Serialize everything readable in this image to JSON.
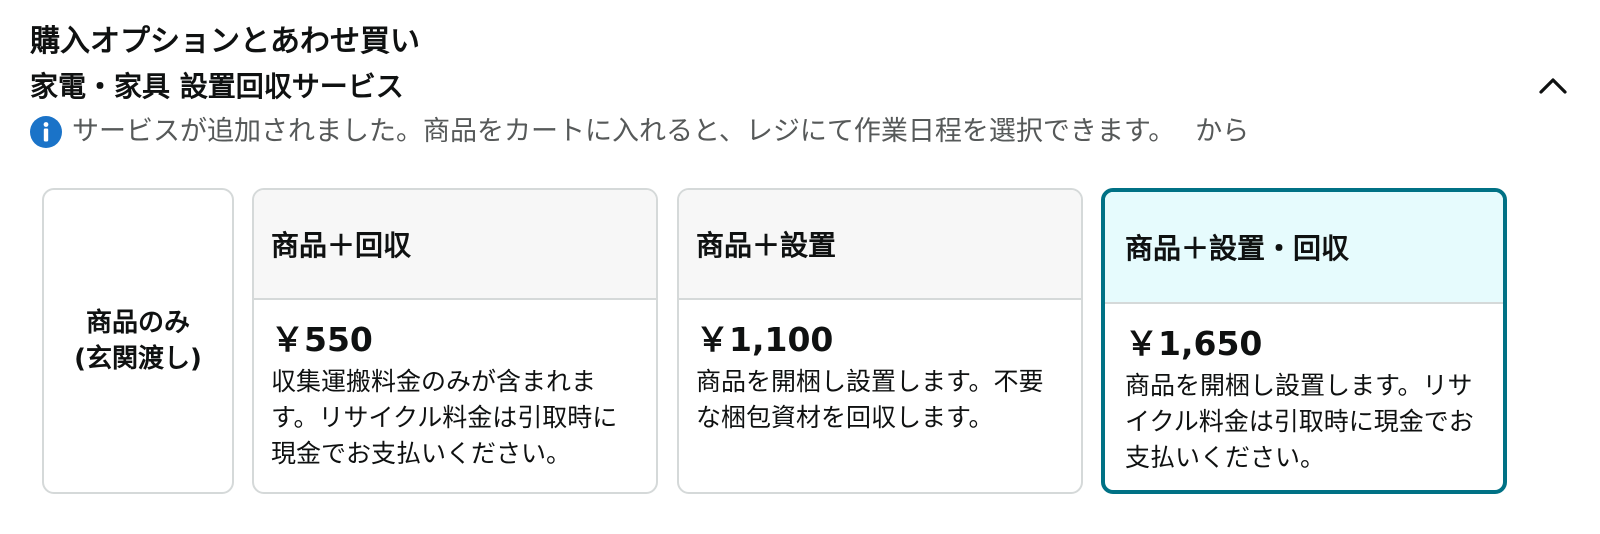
{
  "header": {
    "title": "購入オプションとあわせ買い",
    "subtitle": "家電・家具 設置回収サービス"
  },
  "notice": {
    "icon": "info-icon",
    "text": "サービスが追加されました。商品をカートに入れると、レジにて作業日程を選択できます。",
    "link": "から"
  },
  "colors": {
    "accent": "#007185",
    "selected_bg": "#e6fbfd",
    "info_icon": "#1a73c8",
    "border": "#d5d9d9"
  },
  "options": {
    "product_only": {
      "label": "商品のみ\n(玄関渡し)"
    },
    "items": [
      {
        "title": "商品＋回収",
        "price": "￥550",
        "description": "収集運搬料金のみが含まれます。リサイクル料金は引取時に現金でお支払いください。",
        "selected": false
      },
      {
        "title": "商品＋設置",
        "price": "￥1,100",
        "description": "商品を開梱し設置します。不要な梱包資材を回収します。",
        "selected": false
      },
      {
        "title": "商品＋設置・回収",
        "price": "￥1,650",
        "description": "商品を開梱し設置します。リサイクル料金は引取時に現金でお支払いください。",
        "selected": true
      }
    ]
  }
}
